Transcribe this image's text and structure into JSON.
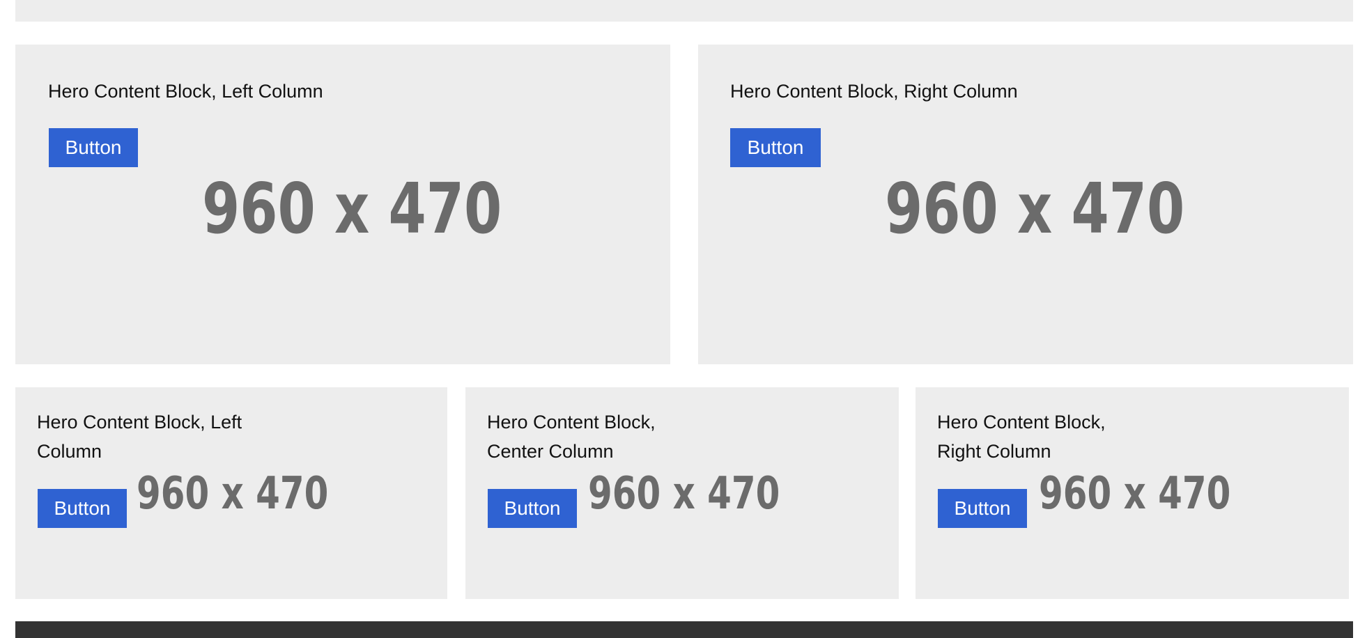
{
  "colors": {
    "panel_bg": "#ededed",
    "button_bg": "#2f62d2",
    "button_text": "#ffffff",
    "placeholder_text": "#6b6b6b",
    "footer_bg": "#333333"
  },
  "two_column_row": {
    "left": {
      "title": "Hero Content Block, Left Column",
      "button_label": "Button",
      "image_placeholder": "960 x 470"
    },
    "right": {
      "title": "Hero Content Block, Right Column",
      "button_label": "Button",
      "image_placeholder": "960 x 470"
    }
  },
  "three_column_row": {
    "left": {
      "title": "Hero Content Block, Left Column",
      "button_label": "Button",
      "image_placeholder": "960 x 470"
    },
    "center": {
      "title": "Hero Content Block, Center Column",
      "button_label": "Button",
      "image_placeholder": "960 x 470"
    },
    "right": {
      "title": "Hero Content Block, Right Column",
      "button_label": "Button",
      "image_placeholder": "960 x 470"
    }
  }
}
